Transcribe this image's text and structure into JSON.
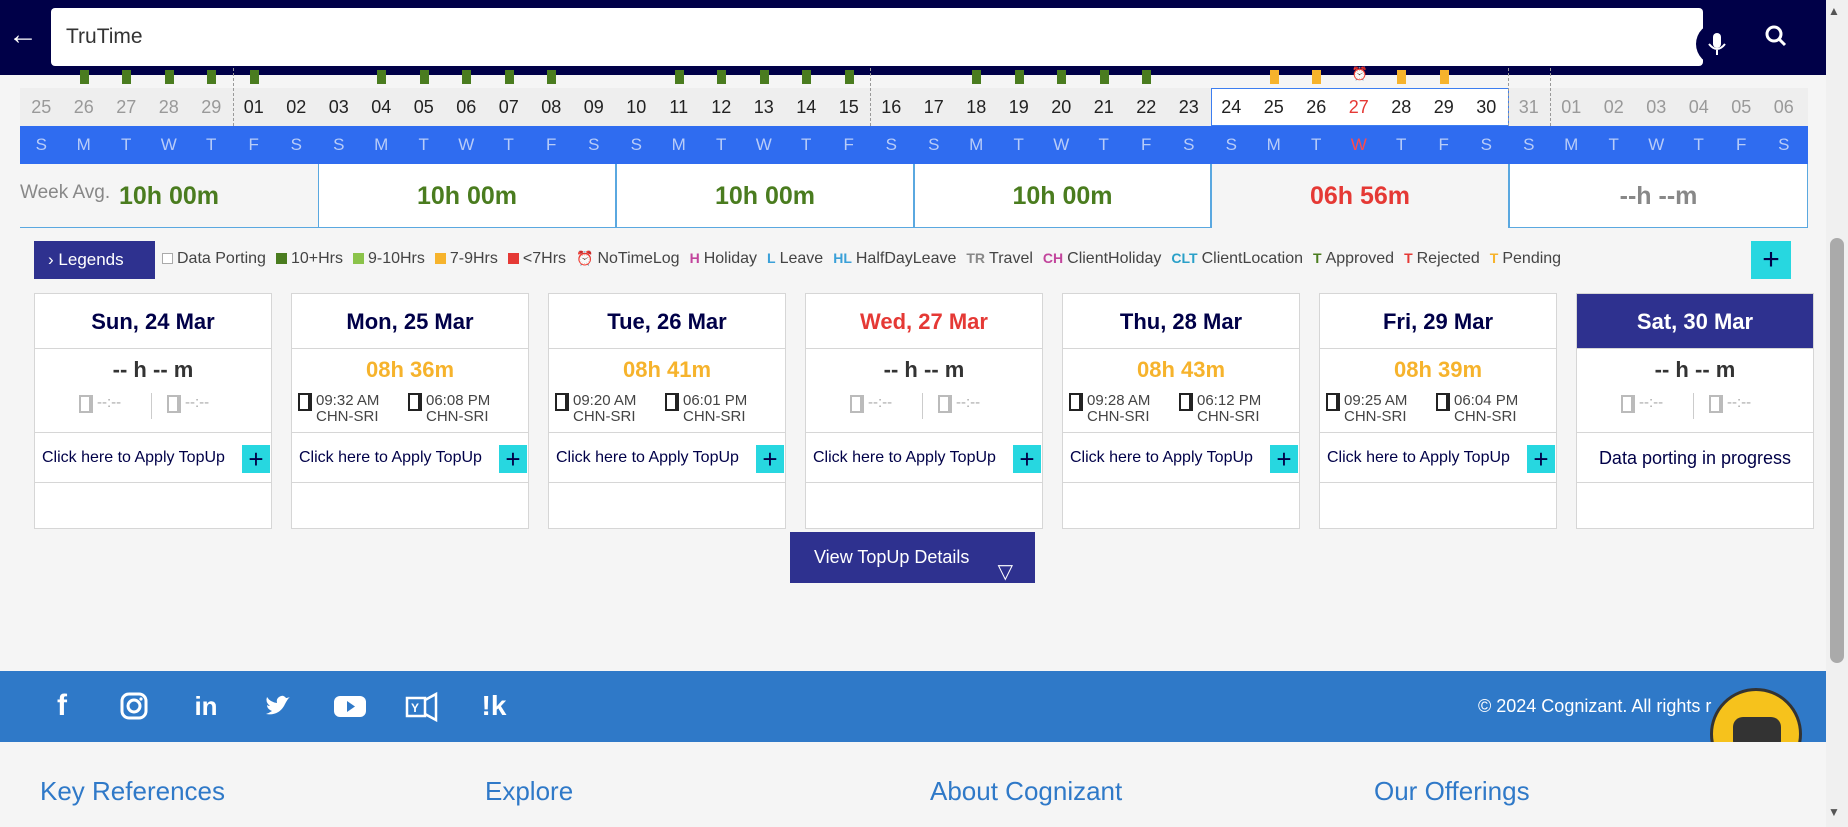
{
  "search": {
    "query": "TruTime"
  },
  "dates": [
    "25",
    "26",
    "27",
    "28",
    "29",
    "01",
    "02",
    "03",
    "04",
    "05",
    "06",
    "07",
    "08",
    "09",
    "10",
    "11",
    "12",
    "13",
    "14",
    "15",
    "16",
    "17",
    "18",
    "19",
    "20",
    "21",
    "22",
    "23",
    "24",
    "25",
    "26",
    "27",
    "28",
    "29",
    "30",
    "31",
    "01",
    "02",
    "03",
    "04",
    "05",
    "06"
  ],
  "days": [
    "S",
    "M",
    "T",
    "W",
    "T",
    "F",
    "S",
    "S",
    "M",
    "T",
    "W",
    "T",
    "F",
    "S",
    "S",
    "M",
    "T",
    "W",
    "T",
    "F",
    "S",
    "S",
    "M",
    "T",
    "W",
    "T",
    "F",
    "S",
    "S",
    "M",
    "T",
    "W",
    "T",
    "F",
    "S",
    "S",
    "M",
    "T",
    "W",
    "T",
    "F",
    "S"
  ],
  "week_avg": {
    "label": "Week Avg.",
    "values": [
      "10h 00m",
      "10h 00m",
      "10h 00m",
      "10h 00m",
      "06h 56m",
      "--h --m"
    ]
  },
  "legends": {
    "button_label": "Legends",
    "items": [
      {
        "marker": "",
        "label": "Data Porting",
        "color": "#ffffff"
      },
      {
        "marker": "",
        "label": "10+Hrs",
        "color": "#4a7c1f"
      },
      {
        "marker": "",
        "label": "9-10Hrs",
        "color": "#8bc34a"
      },
      {
        "marker": "",
        "label": "7-9Hrs",
        "color": "#f6b32c"
      },
      {
        "marker": "",
        "label": "<7Hrs",
        "color": "#e53935"
      },
      {
        "marker": "⏰",
        "label": "NoTimeLog",
        "color": "#e57373"
      },
      {
        "marker": "H",
        "label": "Holiday",
        "color": "#c2449c"
      },
      {
        "marker": "L",
        "label": "Leave",
        "color": "#3aa0d8"
      },
      {
        "marker": "HL",
        "label": "HalfDayLeave",
        "color": "#3aa0d8"
      },
      {
        "marker": "TR",
        "label": "Travel",
        "color": "#888888"
      },
      {
        "marker": "CH",
        "label": "ClientHoliday",
        "color": "#c2449c"
      },
      {
        "marker": "CLT",
        "label": "ClientLocation",
        "color": "#2aa0c8"
      },
      {
        "marker": "T",
        "label": "Approved",
        "color": "#4a7c1f"
      },
      {
        "marker": "T",
        "label": "Rejected",
        "color": "#e53935"
      },
      {
        "marker": "T",
        "label": "Pending",
        "color": "#f6b32c"
      }
    ]
  },
  "cards": [
    {
      "title": "Sun, 24 Mar",
      "duration": "-- h -- m",
      "in_time": "--:--",
      "in_loc": "",
      "out_time": "--:--",
      "out_loc": "",
      "apply": "Click here to Apply TopUp"
    },
    {
      "title": "Mon, 25 Mar",
      "duration": "08h 36m",
      "in_time": "09:32 AM",
      "in_loc": "CHN-SRI",
      "out_time": "06:08 PM",
      "out_loc": "CHN-SRI",
      "apply": "Click here to Apply TopUp"
    },
    {
      "title": "Tue, 26 Mar",
      "duration": "08h 41m",
      "in_time": "09:20 AM",
      "in_loc": "CHN-SRI",
      "out_time": "06:01 PM",
      "out_loc": "CHN-SRI",
      "apply": "Click here to Apply TopUp"
    },
    {
      "title": "Wed, 27 Mar",
      "duration": "-- h -- m",
      "in_time": "--:--",
      "in_loc": "",
      "out_time": "--:--",
      "out_loc": "",
      "apply": "Click here to Apply TopUp"
    },
    {
      "title": "Thu, 28 Mar",
      "duration": "08h 43m",
      "in_time": "09:28 AM",
      "in_loc": "CHN-SRI",
      "out_time": "06:12 PM",
      "out_loc": "CHN-SRI",
      "apply": "Click here to Apply TopUp"
    },
    {
      "title": "Fri, 29 Mar",
      "duration": "08h 39m",
      "in_time": "09:25 AM",
      "in_loc": "CHN-SRI",
      "out_time": "06:04 PM",
      "out_loc": "CHN-SRI",
      "apply": "Click here to Apply TopUp"
    },
    {
      "title": "Sat, 30 Mar",
      "duration": "-- h -- m",
      "in_time": "--:--",
      "in_loc": "",
      "out_time": "--:--",
      "out_loc": "",
      "apply": "Data porting in progress"
    }
  ],
  "view_topup": "View TopUp Details",
  "footer": {
    "copyright": "© 2024 Cognizant. All rights r",
    "links": [
      "Key References",
      "Explore",
      "About Cognizant",
      "Our Offerings"
    ]
  }
}
